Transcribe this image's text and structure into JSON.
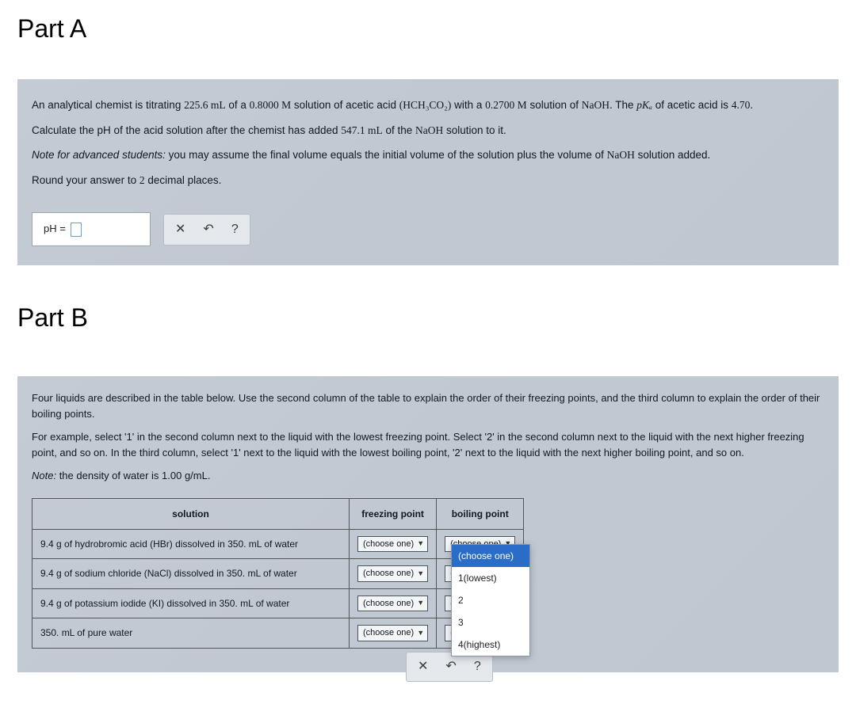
{
  "partA": {
    "title": "Part A",
    "line1_pre": "An analytical chemist is titrating ",
    "vol1": "225.6 mL",
    "line1_mid1": " of a ",
    "conc1": "0.8000 M",
    "line1_mid2": " solution of acetic acid ",
    "formula": "(HCH₃CO₂)",
    "line1_mid3": " with a ",
    "conc2": "0.2700 M",
    "line1_mid4": " solution of ",
    "base": "NaOH",
    "line1_mid5": ". The ",
    "pka_label": "pKₐ",
    "line1_end": " of acetic acid is ",
    "pka_val": "4.70",
    "line1_period": ".",
    "line2_pre": "Calculate the pH of the acid solution after the chemist has added ",
    "vol2": "547.1 mL",
    "line2_mid": " of the ",
    "line2_end": " solution to it.",
    "note_label": "Note for advanced students:",
    "note_text": " you may assume the final volume equals the initial volume of the solution plus the volume of ",
    "note_end": " solution added.",
    "round": "Round your answer to ",
    "round_num": "2",
    "round_end": " decimal places.",
    "ph_label": "pH =",
    "tools": {
      "x": "✕",
      "undo": "↶",
      "help": "?"
    }
  },
  "partB": {
    "title": "Part B",
    "p1": "Four liquids are described in the table below. Use the second column of the table to explain the order of their freezing points, and the third column to explain the order of their boiling points.",
    "p2": "For example, select '1' in the second column next to the liquid with the lowest freezing point. Select '2' in the second column next to the liquid with the next higher freezing point, and so on. In the third column, select '1' next to the liquid with the lowest boiling point, '2' next to the liquid with the next higher boiling point, and so on.",
    "note_label": "Note:",
    "note_text": " the density of water is ",
    "density": "1.00 g/mL",
    "note_period": ".",
    "headers": {
      "solution": "solution",
      "fp": "freezing point",
      "bp": "boiling point"
    },
    "rows": [
      "9.4 g of hydrobromic acid (HBr) dissolved in 350. mL of water",
      "9.4 g of sodium chloride (NaCl) dissolved in 350. mL of water",
      "9.4 g of potassium iodide (KI) dissolved in 350. mL of water",
      "350. mL of pure water"
    ],
    "choose": "(choose one)",
    "dropdown": {
      "opt0": "(choose one)",
      "opt1": "1(lowest)",
      "opt2": "2",
      "opt3": "3",
      "opt4": "4(highest)"
    },
    "tools": {
      "x": "✕",
      "undo": "↶",
      "help": "?"
    }
  }
}
